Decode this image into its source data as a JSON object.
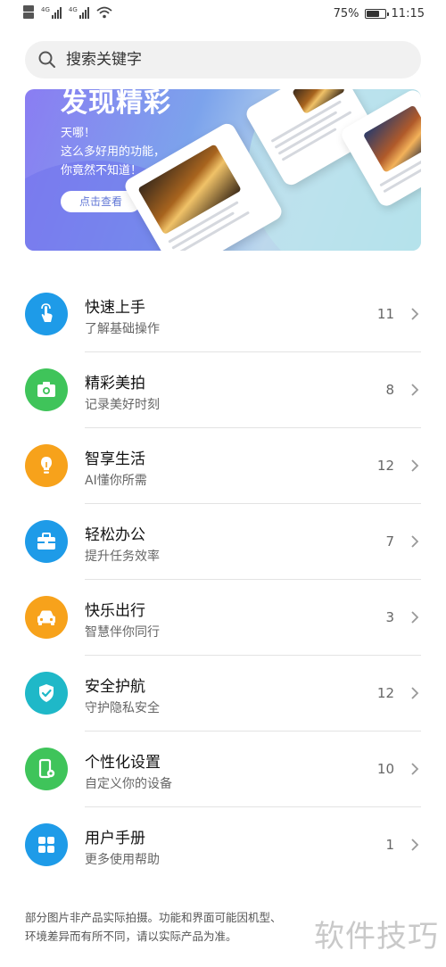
{
  "status_bar": {
    "network_left": "4G",
    "network_right": "4G",
    "battery": "75%",
    "battery_level": 0.75,
    "time": "11:15"
  },
  "search": {
    "placeholder": "搜索关键字"
  },
  "banner": {
    "headline": "发现精彩",
    "lines": [
      "天哪！",
      "这么多好用的功能，",
      "你竟然不知道！"
    ],
    "cta": "点击查看"
  },
  "items": [
    {
      "title": "快速上手",
      "subtitle": "了解基础操作",
      "count": "11",
      "icon": "touch-hand-icon",
      "color": "#1e9be8"
    },
    {
      "title": "精彩美拍",
      "subtitle": "记录美好时刻",
      "count": "8",
      "icon": "camera-icon",
      "color": "#3fc45a"
    },
    {
      "title": "智享生活",
      "subtitle": "AI懂你所需",
      "count": "12",
      "icon": "lightbulb-icon",
      "color": "#f7a21b"
    },
    {
      "title": "轻松办公",
      "subtitle": "提升任务效率",
      "count": "7",
      "icon": "briefcase-icon",
      "color": "#1e9be8"
    },
    {
      "title": "快乐出行",
      "subtitle": "智慧伴你同行",
      "count": "3",
      "icon": "car-icon",
      "color": "#f7a21b"
    },
    {
      "title": "安全护航",
      "subtitle": "守护隐私安全",
      "count": "12",
      "icon": "shield-check-icon",
      "color": "#1fb8c8"
    },
    {
      "title": "个性化设置",
      "subtitle": "自定义你的设备",
      "count": "10",
      "icon": "phone-settings-icon",
      "color": "#3fc45a"
    },
    {
      "title": "用户手册",
      "subtitle": "更多使用帮助",
      "count": "1",
      "icon": "grid-icon",
      "color": "#1e9be8"
    }
  ],
  "footer": {
    "line1": "部分图片非产品实际拍摄。功能和界面可能因机型、",
    "line2": "环境差异而有所不同，请以实际产品为准。"
  },
  "watermark": "软件技巧"
}
